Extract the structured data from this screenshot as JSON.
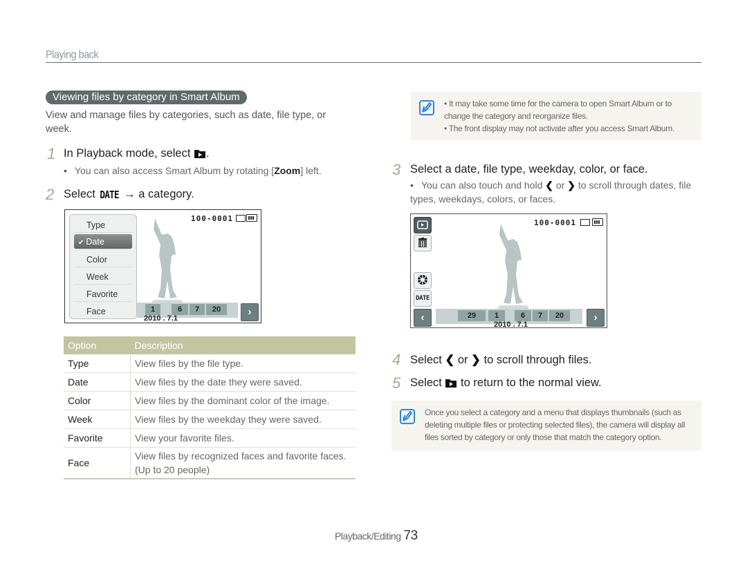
{
  "header": {
    "section_title": "Playing back"
  },
  "left": {
    "pill_title": "Viewing files by category in Smart Album",
    "intro": "View and manage files by categories, such as date, file type, or week.",
    "step1": {
      "num": "1",
      "text_before": "In Playback mode, select",
      "text_after": ".",
      "icon": "smart-album-icon"
    },
    "step1_bullet": {
      "before": "You can also access Smart Album by rotating [",
      "key": "Zoom",
      "after": "] left."
    },
    "step2": {
      "num": "2",
      "before": "Select",
      "date_glyph": "DATE",
      "after": "→ a category."
    },
    "screen1": {
      "file_number": "100-0001",
      "menu_items": [
        {
          "label": "Type",
          "selected": false
        },
        {
          "label": "Date",
          "selected": true
        },
        {
          "label": "Color",
          "selected": false
        },
        {
          "label": "Week",
          "selected": false
        },
        {
          "label": "Favorite",
          "selected": false
        },
        {
          "label": "Face",
          "selected": false
        }
      ],
      "timeline_cells": [
        "1",
        "6",
        "7",
        "20"
      ],
      "date_label": "2010 . 7.1",
      "check_mark": "✔",
      "next_glyph": "›"
    },
    "table": {
      "headers": [
        "Option",
        "Description"
      ],
      "rows": [
        {
          "option": "Type",
          "description": "View files by the file type."
        },
        {
          "option": "Date",
          "description": "View files by the date they were saved."
        },
        {
          "option": "Color",
          "description": "View files by the dominant color of the image."
        },
        {
          "option": "Week",
          "description": "View files by the weekday they were saved."
        },
        {
          "option": "Favorite",
          "description": "View your favorite files."
        },
        {
          "option": "Face",
          "description": "View files by recognized faces and favorite faces. (Up to 20 people)"
        }
      ]
    }
  },
  "right": {
    "note1": {
      "bullets": [
        "It may take some time for the camera to open Smart Album or to change the category and reorganize files.",
        "The front display may not activate after you access Smart Album."
      ]
    },
    "step3": {
      "num": "3",
      "text": "Select a date, file type, weekday, color, or face."
    },
    "step3_bullet": {
      "before": "You can also touch and hold",
      "or": "or",
      "after": "to scroll through dates, file types, weekdays, colors, or faces."
    },
    "screen2": {
      "file_number": "100-0001",
      "side_buttons": [
        "play",
        "trash",
        "color",
        "DATE"
      ],
      "timeline_cells": [
        "29",
        "1",
        "6",
        "7",
        "20"
      ],
      "date_label": "2010 . 7.1",
      "prev_glyph": "‹",
      "next_glyph": "›"
    },
    "step4": {
      "num": "4",
      "before": "Select",
      "or": "or",
      "after": "to scroll through files."
    },
    "step5": {
      "num": "5",
      "before": "Select",
      "after": "to return to the normal view."
    },
    "note2": {
      "text": "Once you select a category and a menu that displays thumbnails (such as deleting multiple files or protecting selected files), the camera will display all files sorted by category or only those that match the category option."
    }
  },
  "footer": {
    "section": "Playback/Editing",
    "page": "73"
  },
  "colors": {
    "accent_green": "#9fae8a",
    "table_header": "#c3c5a2",
    "note_icon": "#2f86e0",
    "pill": "#606a6b"
  }
}
